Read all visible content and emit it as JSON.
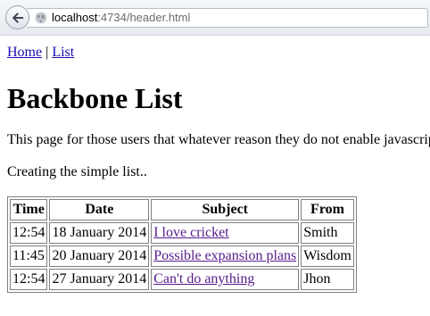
{
  "browser": {
    "url_host": "localhost",
    "url_rest": ":4734/header.html"
  },
  "nav": {
    "home_label": "Home",
    "separator": "|",
    "list_label": "List"
  },
  "page": {
    "title": "Backbone List",
    "intro": "This page for those users that whatever reason they do not enable javascript.",
    "list_caption": "Creating the simple list.."
  },
  "table": {
    "headers": [
      "Time",
      "Date",
      "Subject",
      "From"
    ],
    "rows": [
      {
        "time": "12:54",
        "date": "18 January 2014",
        "subject": "I love cricket",
        "from": "Smith"
      },
      {
        "time": "11:45",
        "date": "20 January 2014",
        "subject": "Possible expansion plans",
        "from": "Wisdom"
      },
      {
        "time": "12:54",
        "date": "27 January 2014",
        "subject": "Can't do anything",
        "from": "Jhon"
      }
    ]
  }
}
